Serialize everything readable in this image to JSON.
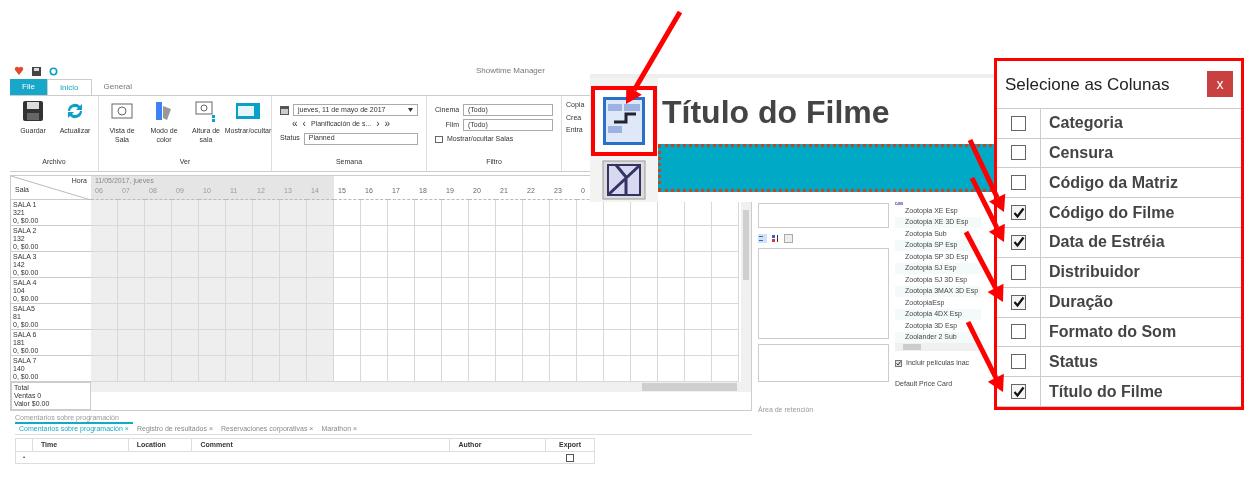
{
  "window": {
    "title": "Showtime Manager"
  },
  "ribbon_tabs": [
    {
      "label": "File",
      "kind": "file",
      "selected": false
    },
    {
      "label": "Inicio",
      "kind": "tab",
      "selected": true
    },
    {
      "label": "General",
      "kind": "tab",
      "selected": false
    }
  ],
  "ribbon": {
    "archivo": {
      "label": "Archivo",
      "buttons": [
        {
          "label": "Guardar"
        },
        {
          "label": "Actualizar"
        }
      ]
    },
    "ver": {
      "label": "Ver",
      "buttons": [
        {
          "label": "Vista de Sala"
        },
        {
          "label": "Modo de color"
        },
        {
          "label": "Altura de sala"
        },
        {
          "label": "Mostrar/ocultar"
        }
      ]
    },
    "semana": {
      "label": "Semana",
      "date": "jueves, 11 de mayo de 2017",
      "nav_first": "«",
      "nav_prev": "‹",
      "nav_label": "Planificación de s...",
      "nav_next": "›",
      "nav_last": "»",
      "status_label": "Status",
      "status_value": "Planned"
    },
    "filtro": {
      "label": "Filtro",
      "cinema_label": "Cinema",
      "cinema_value": "(Todo)",
      "film_label": "Film",
      "film_value": "(Todo)",
      "toggle": "Mostrar/ocultar Salas"
    },
    "extra": [
      "Copia",
      "Crea",
      "Entra"
    ]
  },
  "schedule": {
    "corner_hour": "Hora",
    "corner_room": "Sala",
    "date": "11/05/2017, jueves",
    "hours": [
      {
        "label": "06",
        "past": true
      },
      {
        "label": "07",
        "past": true
      },
      {
        "label": "08",
        "past": true
      },
      {
        "label": "09",
        "past": true
      },
      {
        "label": "10",
        "past": true
      },
      {
        "label": "11",
        "past": true
      },
      {
        "label": "12",
        "past": true
      },
      {
        "label": "13",
        "past": true
      },
      {
        "label": "14",
        "past": true
      },
      {
        "label": "15",
        "past": false
      },
      {
        "label": "16",
        "past": false
      },
      {
        "label": "17",
        "past": false
      },
      {
        "label": "18",
        "past": false
      },
      {
        "label": "19",
        "past": false
      },
      {
        "label": "20",
        "past": false
      },
      {
        "label": "21",
        "past": false
      },
      {
        "label": "22",
        "past": false
      },
      {
        "label": "23",
        "past": false
      },
      {
        "label": "0",
        "past": false
      }
    ],
    "rooms": [
      {
        "name": "SALA 1",
        "seats": "321",
        "sales": "0, $0.00"
      },
      {
        "name": "SALA 2",
        "seats": "132",
        "sales": "0, $0.00"
      },
      {
        "name": "SALA 3",
        "seats": "142",
        "sales": "0, $0.00"
      },
      {
        "name": "SALA 4",
        "seats": "104",
        "sales": "0, $0.00"
      },
      {
        "name": "SALA5",
        "seats": "81",
        "sales": "0, $0.00"
      },
      {
        "name": "SALA 6",
        "seats": "181",
        "sales": "0, $0.00"
      },
      {
        "name": "SALA 7",
        "seats": "140",
        "sales": "0, $0.00"
      }
    ],
    "total": {
      "label": "Total",
      "ventas": "Ventas 0",
      "valor": "Valor $0.00"
    }
  },
  "comments": {
    "title": "Comentarios sobre programación",
    "tabs": [
      {
        "label": "Comentarios sobre programación",
        "close": "×",
        "selected": true
      },
      {
        "label": "Registro de resultados",
        "close": "×",
        "selected": false
      },
      {
        "label": "Reservaciones corporativas",
        "close": "×",
        "selected": false
      },
      {
        "label": "Marathon",
        "close": "×",
        "selected": false
      }
    ],
    "columns": [
      "Time",
      "Location",
      "Comment",
      "Author",
      "Export"
    ],
    "row": {
      "marker": "•",
      "export": false
    }
  },
  "retention": {
    "title": "Área de retención"
  },
  "films": {
    "items": [
      "Zootopia XE Esp",
      "Zootopia XE 3D Esp",
      "Zootopia Sub",
      "Zootopia SP Esp",
      "Zootopia SP 3D Esp",
      "Zootopia SJ Esp",
      "Zootopia SJ 3D Esp",
      "Zootopia 3MAX 3D Esp",
      "ZootopiaEsp",
      "Zootopia 4DX Esp",
      "Zootopia 3D Esp",
      "Zoolander 2 Sub"
    ],
    "include_inactive": {
      "label": "Incluir películas inac",
      "checked": true
    },
    "price_card": "Default Price Card"
  },
  "zoom_callout": {
    "title": "Título do Filme"
  },
  "column_picker": {
    "title": "Selecione as Colunas",
    "close": "x",
    "columns": [
      {
        "label": "Categoria",
        "checked": false
      },
      {
        "label": "Censura",
        "checked": false
      },
      {
        "label": "Código da Matriz",
        "checked": false
      },
      {
        "label": "Código do Filme",
        "checked": true
      },
      {
        "label": "Data de Estréia",
        "checked": true
      },
      {
        "label": "Distribuidor",
        "checked": false
      },
      {
        "label": "Duração",
        "checked": true
      },
      {
        "label": "Formato do Som",
        "checked": false
      },
      {
        "label": "Status",
        "checked": false
      },
      {
        "label": "Título do Filme",
        "checked": true
      }
    ]
  }
}
